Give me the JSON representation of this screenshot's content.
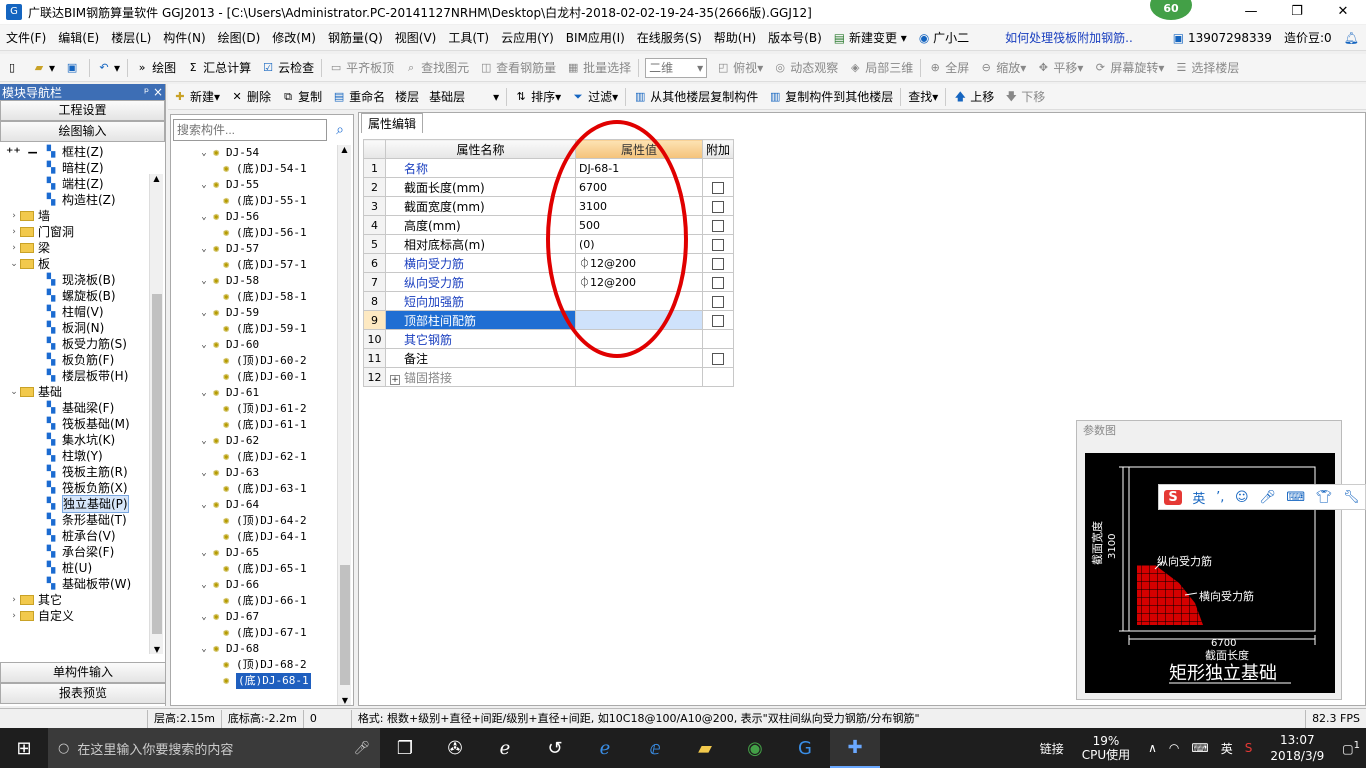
{
  "window": {
    "title": "广联达BIM钢筋算量软件 GGJ2013 - [C:\\Users\\Administrator.PC-20141127NRHM\\Desktop\\白龙村-2018-02-02-19-24-35(2666版).GGJ12]",
    "badge": "60"
  },
  "menu": [
    "文件(F)",
    "编辑(E)",
    "楼层(L)",
    "构件(N)",
    "绘图(D)",
    "修改(M)",
    "钢筋量(Q)",
    "视图(V)",
    "工具(T)",
    "云应用(Y)",
    "BIM应用(I)",
    "在线服务(S)",
    "帮助(H)",
    "版本号(B)"
  ],
  "menu_right": {
    "new_change": "新建变更",
    "assistant": "广小二",
    "question": "如何处理筏板附加钢筋..",
    "phone": "13907298339",
    "beans": "造价豆:0"
  },
  "toolbar1": {
    "draw": "绘图",
    "calc": "汇总计算",
    "cloud_check": "云检查",
    "flat_top": "平齐板顶",
    "find_elem": "查找图元",
    "view_steel": "查看钢筋量",
    "batch_select": "批量选择",
    "view_mode": "二维",
    "top_view": "俯视",
    "dynamic": "动态观察",
    "local3d": "局部三维",
    "full_screen": "全屏",
    "zoom": "缩放",
    "pan": "平移",
    "rotate": "屏幕旋转",
    "select_floor": "选择楼层"
  },
  "nav": {
    "header": "模块导航栏",
    "pin": "ᵖ ×",
    "project_settings": "工程设置",
    "drawing_input": "绘图输入",
    "single_input": "单构件输入",
    "report": "报表预览",
    "tree": [
      {
        "label": "框柱(Z)",
        "level": 2,
        "type": "comp"
      },
      {
        "label": "暗柱(Z)",
        "level": 2,
        "type": "comp"
      },
      {
        "label": "端柱(Z)",
        "level": 2,
        "type": "comp"
      },
      {
        "label": "构造柱(Z)",
        "level": 2,
        "type": "comp"
      },
      {
        "label": "墙",
        "level": 1,
        "type": "folder",
        "exp": "›"
      },
      {
        "label": "门窗洞",
        "level": 1,
        "type": "folder",
        "exp": "›"
      },
      {
        "label": "梁",
        "level": 1,
        "type": "folder",
        "exp": "›"
      },
      {
        "label": "板",
        "level": 1,
        "type": "folder",
        "exp": "⌄"
      },
      {
        "label": "现浇板(B)",
        "level": 2,
        "type": "comp"
      },
      {
        "label": "螺旋板(B)",
        "level": 2,
        "type": "comp"
      },
      {
        "label": "柱帽(V)",
        "level": 2,
        "type": "comp"
      },
      {
        "label": "板洞(N)",
        "level": 2,
        "type": "comp"
      },
      {
        "label": "板受力筋(S)",
        "level": 2,
        "type": "comp"
      },
      {
        "label": "板负筋(F)",
        "level": 2,
        "type": "comp"
      },
      {
        "label": "楼层板带(H)",
        "level": 2,
        "type": "comp"
      },
      {
        "label": "基础",
        "level": 1,
        "type": "folder",
        "exp": "⌄"
      },
      {
        "label": "基础梁(F)",
        "level": 2,
        "type": "comp"
      },
      {
        "label": "筏板基础(M)",
        "level": 2,
        "type": "comp"
      },
      {
        "label": "集水坑(K)",
        "level": 2,
        "type": "comp"
      },
      {
        "label": "柱墩(Y)",
        "level": 2,
        "type": "comp"
      },
      {
        "label": "筏板主筋(R)",
        "level": 2,
        "type": "comp"
      },
      {
        "label": "筏板负筋(X)",
        "level": 2,
        "type": "comp"
      },
      {
        "label": "独立基础(P)",
        "level": 2,
        "type": "comp",
        "sel": true
      },
      {
        "label": "条形基础(T)",
        "level": 2,
        "type": "comp"
      },
      {
        "label": "桩承台(V)",
        "level": 2,
        "type": "comp"
      },
      {
        "label": "承台梁(F)",
        "level": 2,
        "type": "comp"
      },
      {
        "label": "桩(U)",
        "level": 2,
        "type": "comp"
      },
      {
        "label": "基础板带(W)",
        "level": 2,
        "type": "comp"
      },
      {
        "label": "其它",
        "level": 1,
        "type": "folder",
        "exp": "›"
      },
      {
        "label": "自定义",
        "level": 1,
        "type": "folder",
        "exp": "›"
      }
    ]
  },
  "toolbar2": {
    "new": "新建",
    "delete": "删除",
    "copy": "复制",
    "rename": "重命名",
    "floor_label": "楼层",
    "floor_value": "基础层",
    "sort": "排序",
    "filter": "过滤",
    "copy_from": "从其他楼层复制构件",
    "copy_to": "复制构件到其他楼层",
    "find": "查找",
    "move_up": "上移",
    "move_down": "下移"
  },
  "component_list": {
    "search_placeholder": "搜索构件...",
    "items": [
      {
        "label": "DJ-54",
        "level": 0
      },
      {
        "label": "(底)DJ-54-1",
        "level": 1
      },
      {
        "label": "DJ-55",
        "level": 0
      },
      {
        "label": "(底)DJ-55-1",
        "level": 1
      },
      {
        "label": "DJ-56",
        "level": 0
      },
      {
        "label": "(底)DJ-56-1",
        "level": 1
      },
      {
        "label": "DJ-57",
        "level": 0
      },
      {
        "label": "(底)DJ-57-1",
        "level": 1
      },
      {
        "label": "DJ-58",
        "level": 0
      },
      {
        "label": "(底)DJ-58-1",
        "level": 1
      },
      {
        "label": "DJ-59",
        "level": 0
      },
      {
        "label": "(底)DJ-59-1",
        "level": 1
      },
      {
        "label": "DJ-60",
        "level": 0
      },
      {
        "label": "(顶)DJ-60-2",
        "level": 1
      },
      {
        "label": "(底)DJ-60-1",
        "level": 1
      },
      {
        "label": "DJ-61",
        "level": 0
      },
      {
        "label": "(顶)DJ-61-2",
        "level": 1
      },
      {
        "label": "(底)DJ-61-1",
        "level": 1
      },
      {
        "label": "DJ-62",
        "level": 0
      },
      {
        "label": "(底)DJ-62-1",
        "level": 1
      },
      {
        "label": "DJ-63",
        "level": 0
      },
      {
        "label": "(底)DJ-63-1",
        "level": 1
      },
      {
        "label": "DJ-64",
        "level": 0
      },
      {
        "label": "(顶)DJ-64-2",
        "level": 1
      },
      {
        "label": "(底)DJ-64-1",
        "level": 1
      },
      {
        "label": "DJ-65",
        "level": 0
      },
      {
        "label": "(底)DJ-65-1",
        "level": 1
      },
      {
        "label": "DJ-66",
        "level": 0
      },
      {
        "label": "(底)DJ-66-1",
        "level": 1
      },
      {
        "label": "DJ-67",
        "level": 0
      },
      {
        "label": "(底)DJ-67-1",
        "level": 1
      },
      {
        "label": "DJ-68",
        "level": 0
      },
      {
        "label": "(顶)DJ-68-2",
        "level": 1
      },
      {
        "label": "(底)DJ-68-1",
        "level": 1,
        "sel": true
      }
    ]
  },
  "props": {
    "tab": "属性编辑",
    "col_name": "属性名称",
    "col_value": "属性值",
    "col_add": "附加",
    "rows": [
      {
        "n": "1",
        "name": "名称",
        "value": "DJ-68-1",
        "style": "blue",
        "chk": false
      },
      {
        "n": "2",
        "name": "截面长度(mm)",
        "value": "6700",
        "style": "",
        "chk": true
      },
      {
        "n": "3",
        "name": "截面宽度(mm)",
        "value": "3100",
        "style": "",
        "chk": true
      },
      {
        "n": "4",
        "name": "高度(mm)",
        "value": "500",
        "style": "",
        "chk": true
      },
      {
        "n": "5",
        "name": "相对底标高(m)",
        "value": "(0)",
        "style": "",
        "chk": true
      },
      {
        "n": "6",
        "name": "横向受力筋",
        "value": "⏀12@200",
        "style": "blue",
        "chk": true
      },
      {
        "n": "7",
        "name": "纵向受力筋",
        "value": "⏀12@200",
        "style": "blue",
        "chk": true
      },
      {
        "n": "8",
        "name": "短向加强筋",
        "value": "",
        "style": "blue",
        "chk": true
      },
      {
        "n": "9",
        "name": "顶部柱间配筋",
        "value": "",
        "style": "blue",
        "chk": true,
        "sel": true
      },
      {
        "n": "10",
        "name": "其它钢筋",
        "value": "",
        "style": "blue",
        "chk": false
      },
      {
        "n": "11",
        "name": "备注",
        "value": "",
        "style": "",
        "chk": true
      },
      {
        "n": "12",
        "name": "锚固搭接",
        "value": "",
        "style": "gray",
        "chk": false,
        "expand": "+"
      }
    ]
  },
  "param_diagram": {
    "header": "参数图",
    "width_label": "截面宽度",
    "width_value": "3100",
    "long_bar": "纵向受力筋",
    "trans_bar": "横向受力筋",
    "length_value": "6700",
    "length_label": "截面长度",
    "caption": "矩形独立基础"
  },
  "ime": {
    "lang": "英"
  },
  "status": {
    "floor_height": "层高:2.15m",
    "bottom_elev": "底标高:-2.2m",
    "zero": "0",
    "format": "格式: 根数+级别+直径+间距/级别+直径+间距, 如10C18@100/A10@200, 表示\"双柱间纵向受力钢筋/分布钢筋\"",
    "fps": "82.3 FPS"
  },
  "taskbar": {
    "search_placeholder": "在这里输入你要搜索的内容",
    "link": "链接",
    "cpu_pct": "19%",
    "cpu_label": "CPU使用",
    "lang": "英",
    "time": "13:07",
    "date": "2018/3/9",
    "notif": "1"
  },
  "colors": {
    "accent": "#1f6ed3",
    "highlight": "#e00000",
    "nav_header": "#3d6eb5"
  }
}
